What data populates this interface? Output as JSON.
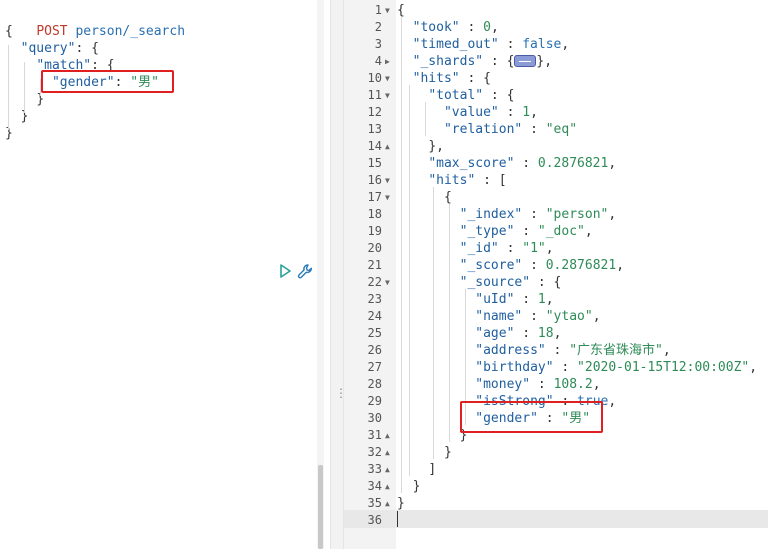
{
  "request": {
    "method": "POST",
    "path": "person/_search",
    "lines": [
      {
        "i": 0,
        "t": "{"
      },
      {
        "i": 1,
        "k": "\"query\"",
        "t": ": {"
      },
      {
        "i": 2,
        "k": "\"match\"",
        "t": ": {"
      },
      {
        "i": 3,
        "k": "\"gender\"",
        "t": ": ",
        "s": "\"男\""
      },
      {
        "i": 2,
        "t": "}"
      },
      {
        "i": 1,
        "t": "}"
      },
      {
        "i": 0,
        "t": "}"
      }
    ]
  },
  "response": {
    "lines": [
      {
        "n": "1",
        "f": "down",
        "i": 0,
        "p": "{"
      },
      {
        "n": "2",
        "i": 1,
        "k": "\"took\"",
        "p": " : ",
        "num": "0",
        "e": ","
      },
      {
        "n": "3",
        "i": 1,
        "k": "\"timed_out\"",
        "p": " : ",
        "bool": "false",
        "e": ","
      },
      {
        "n": "4",
        "f": "right",
        "i": 1,
        "k": "\"_shards\"",
        "p": " : {",
        "badge": true,
        "e": "},"
      },
      {
        "n": "10",
        "f": "down",
        "i": 1,
        "k": "\"hits\"",
        "p": " : {"
      },
      {
        "n": "11",
        "f": "down",
        "i": 2,
        "k": "\"total\"",
        "p": " : {"
      },
      {
        "n": "12",
        "i": 3,
        "k": "\"value\"",
        "p": " : ",
        "num": "1",
        "e": ","
      },
      {
        "n": "13",
        "i": 3,
        "k": "\"relation\"",
        "p": " : ",
        "str": "\"eq\""
      },
      {
        "n": "14",
        "f": "up",
        "i": 2,
        "p": "},"
      },
      {
        "n": "15",
        "i": 2,
        "k": "\"max_score\"",
        "p": " : ",
        "num": "0.2876821",
        "e": ","
      },
      {
        "n": "16",
        "f": "down",
        "i": 2,
        "k": "\"hits\"",
        "p": " : ["
      },
      {
        "n": "17",
        "f": "down",
        "i": 3,
        "p": "{"
      },
      {
        "n": "18",
        "i": 4,
        "k": "\"_index\"",
        "p": " : ",
        "str": "\"person\"",
        "e": ","
      },
      {
        "n": "19",
        "i": 4,
        "k": "\"_type\"",
        "p": " : ",
        "str": "\"_doc\"",
        "e": ","
      },
      {
        "n": "20",
        "i": 4,
        "k": "\"_id\"",
        "p": " : ",
        "str": "\"1\"",
        "e": ","
      },
      {
        "n": "21",
        "i": 4,
        "k": "\"_score\"",
        "p": " : ",
        "num": "0.2876821",
        "e": ","
      },
      {
        "n": "22",
        "f": "down",
        "i": 4,
        "k": "\"_source\"",
        "p": " : {"
      },
      {
        "n": "23",
        "i": 5,
        "k": "\"uId\"",
        "p": " : ",
        "num": "1",
        "e": ","
      },
      {
        "n": "24",
        "i": 5,
        "k": "\"name\"",
        "p": " : ",
        "str": "\"ytao\"",
        "e": ","
      },
      {
        "n": "25",
        "i": 5,
        "k": "\"age\"",
        "p": " : ",
        "num": "18",
        "e": ","
      },
      {
        "n": "26",
        "i": 5,
        "k": "\"address\"",
        "p": " : ",
        "str": "\"广东省珠海市\"",
        "e": ","
      },
      {
        "n": "27",
        "i": 5,
        "k": "\"birthday\"",
        "p": " : ",
        "str": "\"2020-01-15T12:00:00Z\"",
        "e": ","
      },
      {
        "n": "28",
        "i": 5,
        "k": "\"money\"",
        "p": " : ",
        "num": "108.2",
        "e": ","
      },
      {
        "n": "29",
        "i": 5,
        "k": "\"isStrong\"",
        "p": " : ",
        "bool": "true",
        "e": ","
      },
      {
        "n": "30",
        "i": 5,
        "k": "\"gender\"",
        "p": " : ",
        "str": "\"男\""
      },
      {
        "n": "31",
        "f": "up",
        "i": 4,
        "p": "}"
      },
      {
        "n": "32",
        "f": "up",
        "i": 3,
        "p": "}"
      },
      {
        "n": "33",
        "f": "up",
        "i": 2,
        "p": "]"
      },
      {
        "n": "34",
        "f": "up",
        "i": 1,
        "p": "}"
      },
      {
        "n": "35",
        "f": "up",
        "i": 0,
        "p": "}"
      },
      {
        "n": "36",
        "i": 0,
        "p": ""
      }
    ]
  },
  "icons": {
    "run": "play-icon",
    "settings": "wrench-icon",
    "collapsed": "ellipsis-badge",
    "resize": "splitter-grip-icon"
  },
  "colors": {
    "method": "#c0392b",
    "key": "#1f5fa0",
    "string": "#2e8b57",
    "boolean": "#2a6fb0",
    "highlight": "#e02020",
    "run_icon": "#2aa198",
    "wrench_icon": "#2a7ab8"
  }
}
